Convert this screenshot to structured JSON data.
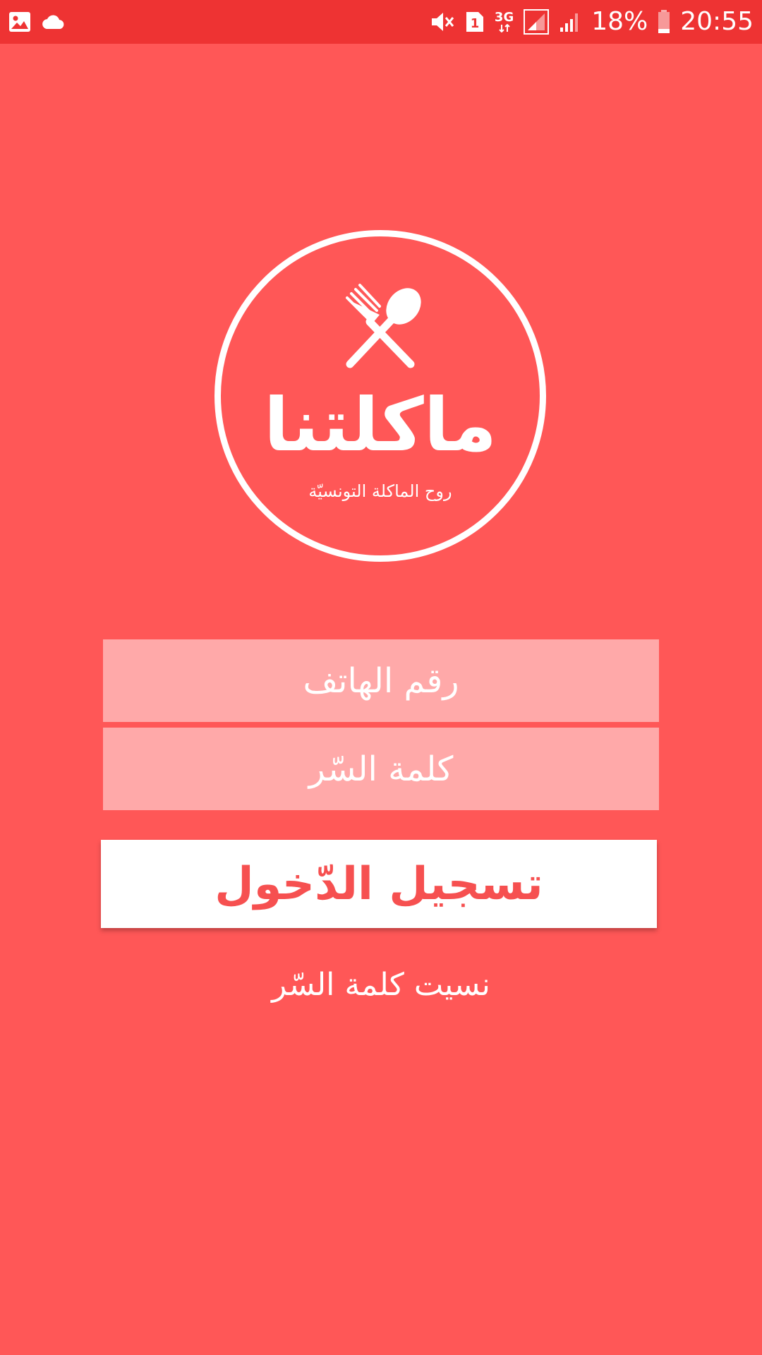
{
  "status_bar": {
    "battery": "18%",
    "time": "20:55",
    "sim_slot": "1",
    "network": "3G",
    "icons": [
      "gallery-icon",
      "cloud-icon",
      "mute-icon",
      "sim-icon",
      "network-3g-icon",
      "signal-icon",
      "signal-icon",
      "battery-icon"
    ]
  },
  "logo": {
    "title": "ماكلتنا",
    "tagline": "روح الماكلة التونسيّة",
    "icon": "utensils-icon"
  },
  "form": {
    "phone_placeholder": "رقم الهاتف",
    "password_placeholder": "كلمة السّر"
  },
  "actions": {
    "login_label": "تسجيل الدّخول",
    "forgot_password": "نسيت كلمة السّر"
  },
  "colors": {
    "background": "#FF5757",
    "status_bar": "#EE3333",
    "field": "#FFA9A9",
    "button_text": "#F65050"
  }
}
